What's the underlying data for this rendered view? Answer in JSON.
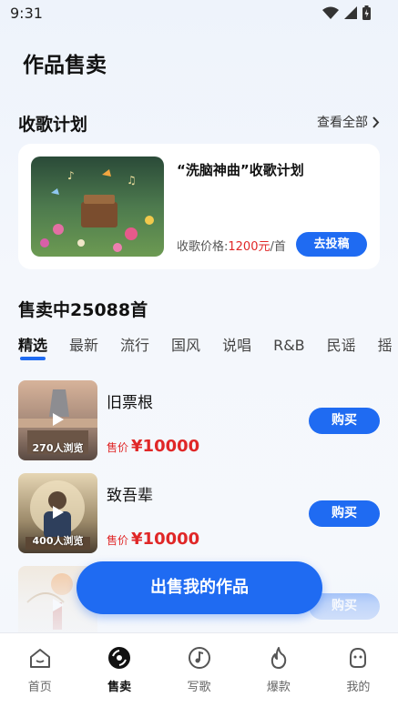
{
  "status_bar": {
    "time": "9:31"
  },
  "page_title": "作品售卖",
  "collect_section": {
    "title": "收歌计划",
    "see_all": "查看全部",
    "plan": {
      "title": "“洗脑神曲”收歌计划",
      "price_label": "收歌价格:",
      "price_value": "1200元",
      "price_unit": "/首",
      "submit_label": "去投稿"
    }
  },
  "sale_section": {
    "title": "售卖中25088首",
    "tabs": [
      "精选",
      "最新",
      "流行",
      "国风",
      "说唱",
      "R&B",
      "民谣",
      "摇"
    ],
    "active_tab": 0,
    "songs": [
      {
        "name": "旧票根",
        "views": "270人浏览",
        "price_label": "售价",
        "price": "¥10000",
        "buy_label": "购买"
      },
      {
        "name": "致吾辈",
        "views": "400人浏览",
        "price_label": "售价",
        "price": "¥10000",
        "buy_label": "购买"
      },
      {
        "name": "",
        "views": "",
        "price_label": "",
        "price": "",
        "buy_label": "购买"
      }
    ]
  },
  "sell_button": "出售我的作品",
  "bottom_nav": [
    {
      "label": "首页",
      "icon": "home-icon"
    },
    {
      "label": "售卖",
      "icon": "disc-icon"
    },
    {
      "label": "写歌",
      "icon": "note-icon"
    },
    {
      "label": "爆款",
      "icon": "fire-icon"
    },
    {
      "label": "我的",
      "icon": "profile-icon"
    }
  ],
  "colors": {
    "accent": "#1f6bf2",
    "price_red": "#e02727"
  }
}
